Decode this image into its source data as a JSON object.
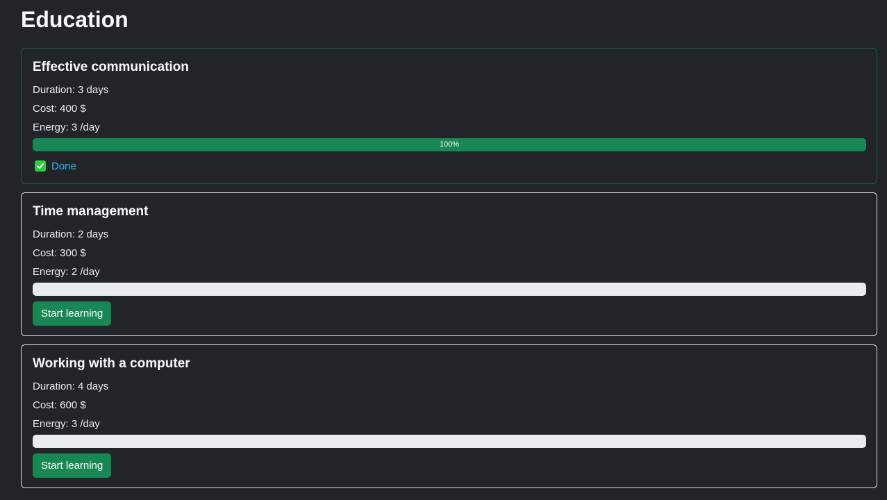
{
  "page": {
    "title": "Education"
  },
  "courses": [
    {
      "title": "Effective communication",
      "duration": "Duration: 3 days",
      "cost": "Cost: 400 $",
      "energy": "Energy: 3 /day",
      "progress": 1.0,
      "progress_label": "100%",
      "status": "Done"
    },
    {
      "title": "Time management",
      "duration": "Duration: 2 days",
      "cost": "Cost: 300 $",
      "energy": "Energy: 2 /day",
      "progress": 0,
      "button_label": "Start learning"
    },
    {
      "title": "Working with a computer",
      "duration": "Duration: 4 days",
      "cost": "Cost: 600 $",
      "energy": "Energy: 3 /day",
      "progress": 0,
      "button_label": "Start learning"
    }
  ],
  "colors": {
    "background": "#212529",
    "accent": "#198754",
    "done_link": "#3ab5e6"
  },
  "icons": {
    "done": "check-box-icon"
  }
}
